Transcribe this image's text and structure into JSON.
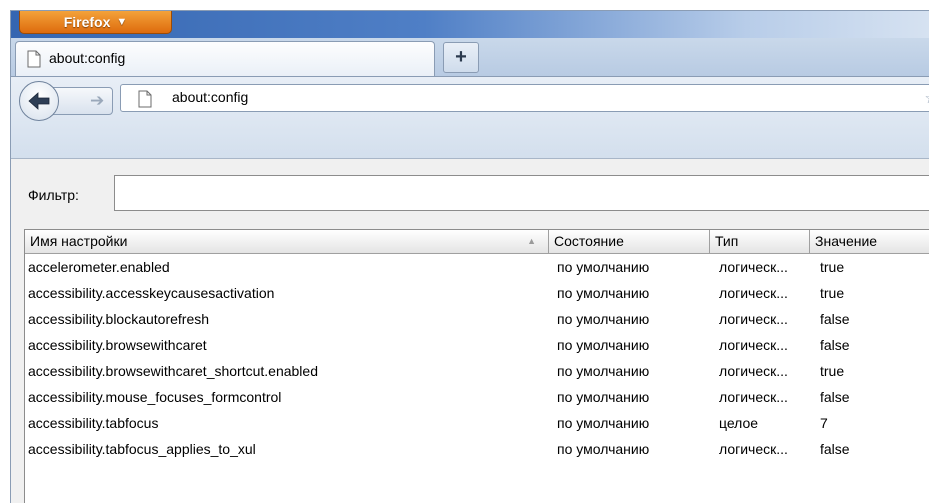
{
  "firefox_menu": {
    "label": "Firefox",
    "arrow": "▼"
  },
  "tabs": [
    {
      "title": "about:config",
      "icon": "page-icon"
    }
  ],
  "new_tab": {
    "label": "+"
  },
  "navigation": {
    "back_icon": "back-arrow-icon",
    "forward_icon": "forward-arrow-icon"
  },
  "urlbar": {
    "url": "about:config",
    "icon": "page-icon"
  },
  "filter": {
    "label": "Фильтр:",
    "value": ""
  },
  "columns": {
    "name": "Имя настройки",
    "status": "Состояние",
    "type": "Тип",
    "value": "Значение"
  },
  "rows": [
    {
      "name": "accelerometer.enabled",
      "status": "по умолчанию",
      "type": "логическ...",
      "value": "true"
    },
    {
      "name": "accessibility.accesskeycausesactivation",
      "status": "по умолчанию",
      "type": "логическ...",
      "value": "true"
    },
    {
      "name": "accessibility.blockautorefresh",
      "status": "по умолчанию",
      "type": "логическ...",
      "value": "false"
    },
    {
      "name": "accessibility.browsewithcaret",
      "status": "по умолчанию",
      "type": "логическ...",
      "value": "false"
    },
    {
      "name": "accessibility.browsewithcaret_shortcut.enabled",
      "status": "по умолчанию",
      "type": "логическ...",
      "value": "true"
    },
    {
      "name": "accessibility.mouse_focuses_formcontrol",
      "status": "по умолчанию",
      "type": "логическ...",
      "value": "false"
    },
    {
      "name": "accessibility.tabfocus",
      "status": "по умолчанию",
      "type": "целое",
      "value": "7"
    },
    {
      "name": "accessibility.tabfocus_applies_to_xul",
      "status": "по умолчанию",
      "type": "логическ...",
      "value": "false"
    }
  ]
}
